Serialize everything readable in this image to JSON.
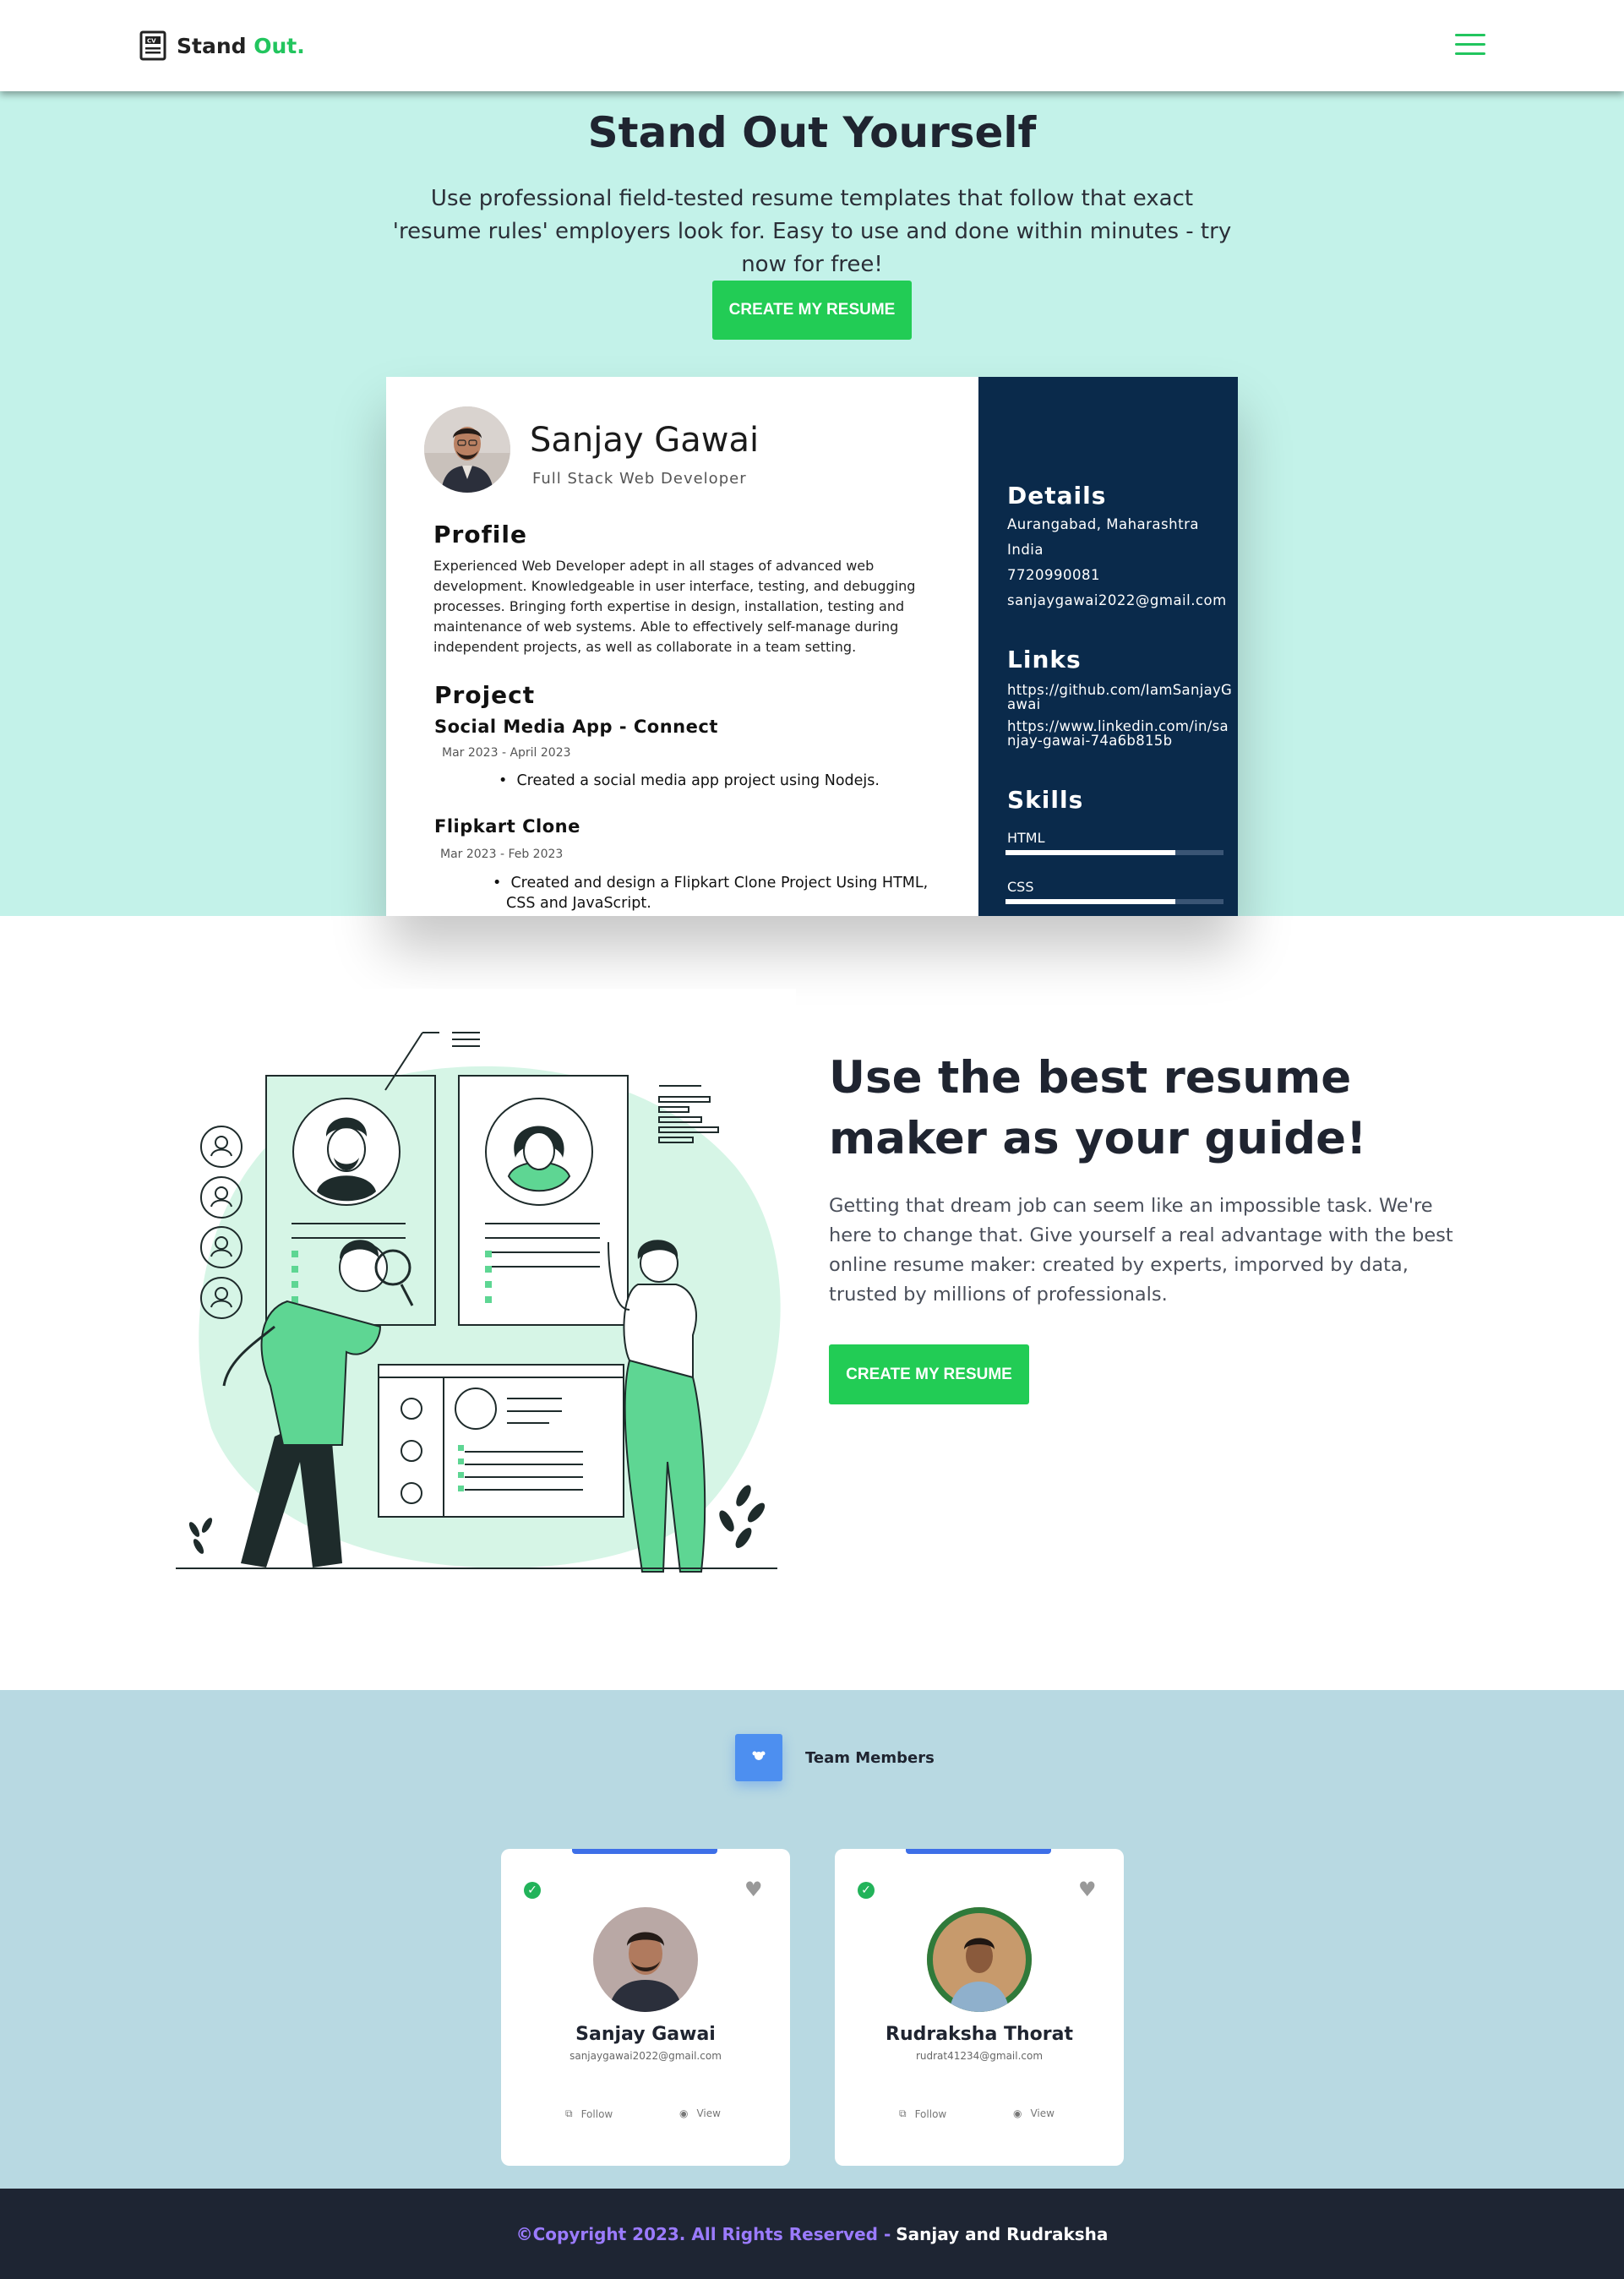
{
  "nav": {
    "brand_main": "Stand ",
    "brand_accent": "Out.",
    "logo_icon": "cv-document-icon",
    "menu_icon": "hamburger-menu-icon"
  },
  "hero": {
    "title": "Stand Out Yourself",
    "subtitle": "Use professional field-tested resume templates that follow that exact 'resume rules' employers look for. Easy to use and done within minutes - try now for free!",
    "cta": "CREATE MY RESUME"
  },
  "resume": {
    "name": "Sanjay Gawai",
    "role": "Full Stack Web Developer",
    "profile_heading": "Profile",
    "profile_text": "Experienced Web Developer adept in all stages of advanced web development. Knowledgeable in user interface, testing, and debugging processes. Bringing forth expertise in design, installation, testing and maintenance of web systems. Able to effectively self-manage during independent projects, as well as collaborate in a team setting.",
    "project_heading": "Project",
    "projects": [
      {
        "title": "Social Media App -  Connect",
        "date": "Mar 2023 -  April 2023",
        "bullet": "Created a social media app project using Nodejs."
      },
      {
        "title": "Flipkart Clone",
        "date": "Mar 2023 -  Feb 2023",
        "bullet": "Created and design a Flipkart Clone Project Using HTML, CSS and JavaScript."
      }
    ],
    "details_heading": "Details",
    "details": [
      "Aurangabad, Maharashtra",
      "India",
      "7720990081",
      "sanjaygawai2022@gmail.com"
    ],
    "links_heading": "Links",
    "links": [
      "https://github.com/IamSanjayGawai",
      "https://www.linkedin.com/in/sanjay-gawai-74a6b815b"
    ],
    "skills_heading": "Skills",
    "skills": [
      {
        "name": "HTML",
        "level": 0.78
      },
      {
        "name": "CSS",
        "level": 0.78
      }
    ]
  },
  "guide": {
    "title": "Use the best resume maker as your guide!",
    "text": "Getting that dream job can seem like an impossible task. We're here to change that. Give yourself a real advantage with the best online resume maker: created by experts, imporved by data, trusted by millions of professionals.",
    "cta": "CREATE MY RESUME"
  },
  "team": {
    "label": "Team Members",
    "members": [
      {
        "name": "Sanjay Gawai",
        "email": "sanjaygawai2022@gmail.com",
        "follow": "Follow",
        "view": "View"
      },
      {
        "name": "Rudraksha Thorat",
        "email": "rudrat41234@gmail.com",
        "follow": "Follow",
        "view": "View"
      }
    ]
  },
  "footer": {
    "copyright": "©Copyright 2023. All Rights Reserved - ",
    "names": "Sanjay and Rudraksha"
  },
  "colors": {
    "accent": "#22cc55",
    "hero_bg": "#c3f2e9",
    "resume_sidebar": "#0a2a4b",
    "team_bg": "#b8d9e2",
    "footer_bg": "#1e2533"
  }
}
